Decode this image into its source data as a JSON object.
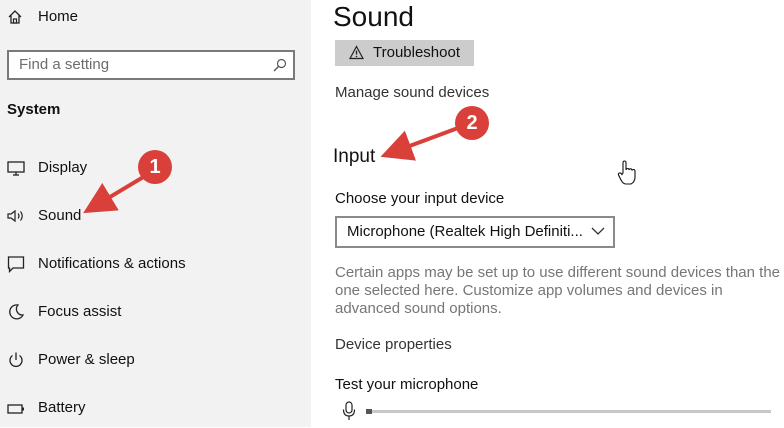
{
  "sidebar": {
    "home_label": "Home",
    "search_placeholder": "Find a setting",
    "section_title": "System",
    "items": [
      {
        "label": "Display",
        "icon": "display-icon"
      },
      {
        "label": "Sound",
        "icon": "speaker-icon"
      },
      {
        "label": "Notifications & actions",
        "icon": "notification-icon"
      },
      {
        "label": "Focus assist",
        "icon": "moon-icon"
      },
      {
        "label": "Power & sleep",
        "icon": "power-icon"
      },
      {
        "label": "Battery",
        "icon": "battery-icon"
      }
    ]
  },
  "main": {
    "title": "Sound",
    "troubleshoot_label": "Troubleshoot",
    "manage_devices_link": "Manage sound devices",
    "input_heading": "Input",
    "choose_input_label": "Choose your input device",
    "input_device_value": "Microphone (Realtek High Definiti...",
    "info_text": "Certain apps may be set up to use different sound devices than the one selected here. Customize app volumes and devices in advanced sound options.",
    "device_properties_link": "Device properties",
    "test_mic_label": "Test your microphone",
    "mic_level": 0.015
  },
  "annotations": {
    "badge_1": "1",
    "badge_2": "2",
    "color": "#d9403a"
  }
}
